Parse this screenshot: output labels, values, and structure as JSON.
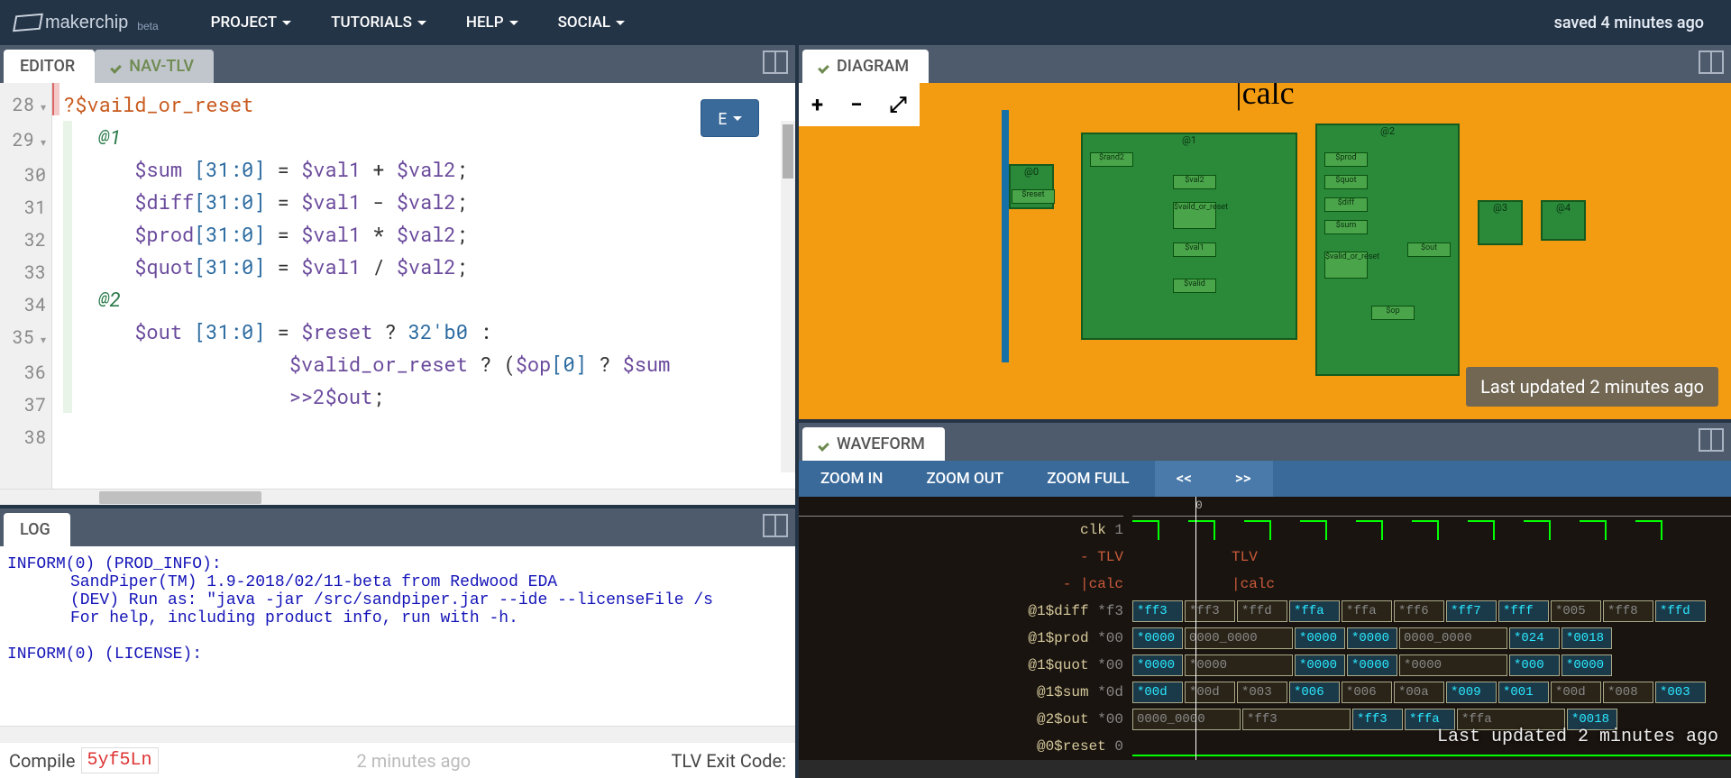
{
  "header": {
    "logo": "makerchip",
    "beta": "beta",
    "menu": [
      "PROJECT",
      "TUTORIALS",
      "HELP",
      "SOCIAL"
    ],
    "status": "saved 4 minutes ago"
  },
  "editor": {
    "tab": "EDITOR",
    "tab2": "NAV-TLV",
    "e_btn": "E",
    "lines": [
      {
        "n": 28,
        "fold": true,
        "text": "?$vaild_or_reset",
        "cls": "q"
      },
      {
        "n": 29,
        "fold": true,
        "text": "   @1",
        "cls": "at"
      },
      {
        "n": 30,
        "text": "      $sum [31:0] = $val1 + $val2;"
      },
      {
        "n": 31,
        "text": "      $diff[31:0] = $val1 - $val2;"
      },
      {
        "n": 32,
        "text": "      $prod[31:0] = $val1 * $val2;"
      },
      {
        "n": 33,
        "text": "      $quot[31:0] = $val1 / $val2;"
      },
      {
        "n": 34,
        "text": ""
      },
      {
        "n": 35,
        "fold": true,
        "text": "   @2",
        "cls": "at"
      },
      {
        "n": 36,
        "text": "      $out [31:0] = $reset ? 32'b0 :"
      },
      {
        "n": 37,
        "text": "                   $valid_or_reset ? ($op[0] ? $sum"
      },
      {
        "n": 38,
        "text": "                   >>2$out;"
      }
    ]
  },
  "log": {
    "tab": "LOG",
    "lines": [
      "INFORM(0) (PROD_INFO):",
      "   SandPiper(TM) 1.9-2018/02/11-beta from Redwood EDA",
      "   (DEV) Run as: \"java -jar /src/sandpiper.jar --ide --licenseFile /s",
      "   For help, including product info, run with -h.",
      "",
      "INFORM(0) (LICENSE):"
    ],
    "compile_label": "Compile",
    "compile_code": "5yf5Ln",
    "ago": "2 minutes ago",
    "exit": "TLV Exit Code:"
  },
  "diagram": {
    "tab": "DIAGRAM",
    "title": "|calc",
    "stages": [
      "@0",
      "@1",
      "@2",
      "@3",
      "@4"
    ],
    "stage0_boxes": [
      "$reset"
    ],
    "stage1_boxes": [
      "$rand2",
      "$val2",
      "$vaild_or_reset",
      "$val1",
      "$valid"
    ],
    "stage2_boxes": [
      "$prod",
      "$quot",
      "$diff",
      "$sum",
      "$valid_or_reset",
      "$out",
      "$op"
    ],
    "status": "Last updated 2 minutes ago"
  },
  "waveform": {
    "tab": "WAVEFORM",
    "zoom_in": "ZOOM IN",
    "zoom_out": "ZOOM OUT",
    "zoom_full": "ZOOM FULL",
    "nav_prev": "<<",
    "nav_next": ">>",
    "ruler_zero": "0",
    "signals": [
      {
        "name": "clk",
        "val": "1",
        "type": "clk"
      },
      {
        "name": "TLV",
        "type": "hdr",
        "label2": "TLV"
      },
      {
        "name": "|calc",
        "type": "hdr",
        "label2": "|calc"
      },
      {
        "name": "@1$diff",
        "val": "*f3",
        "cells": [
          "*ff3",
          "*ff3",
          "*ffd",
          "*ffa",
          "*ffa",
          "*ff6",
          "*ff7",
          "*fff",
          "*005",
          "*ff8",
          "*ffd"
        ],
        "hi": [
          0,
          3,
          6,
          7,
          10
        ]
      },
      {
        "name": "@1$prod",
        "val": "*00",
        "cells": [
          "*0000",
          "0000_0000",
          "*0000",
          "*0000",
          "0000_0000",
          "*024",
          "*0018"
        ],
        "hi": [
          0,
          2,
          3,
          5,
          6
        ],
        "wide": [
          1,
          4
        ]
      },
      {
        "name": "@1$quot",
        "val": "*00",
        "cells": [
          "*0000",
          "*0000",
          "*0000",
          "*0000",
          "*0000",
          "*000",
          "*0000"
        ],
        "hi": [
          0,
          2,
          3,
          5,
          6
        ],
        "wide": [
          1,
          4
        ]
      },
      {
        "name": "@1$sum",
        "val": "*0d",
        "cells": [
          "*00d",
          "*00d",
          "*003",
          "*006",
          "*006",
          "*00a",
          "*009",
          "*001",
          "*00d",
          "*008",
          "*003"
        ],
        "hi": [
          0,
          3,
          6,
          7,
          10
        ]
      },
      {
        "name": "@2$out",
        "val": "*00",
        "cells": [
          "0000_0000",
          "*ff3",
          "*ff3",
          "*ffa",
          "*ffa",
          "*0018"
        ],
        "hi": [
          2,
          3,
          5
        ],
        "wide": [
          0,
          1,
          4
        ]
      },
      {
        "name": "@0$reset",
        "val": "0",
        "type": "bit"
      }
    ],
    "status": "Last updated 2 minutes ago"
  }
}
